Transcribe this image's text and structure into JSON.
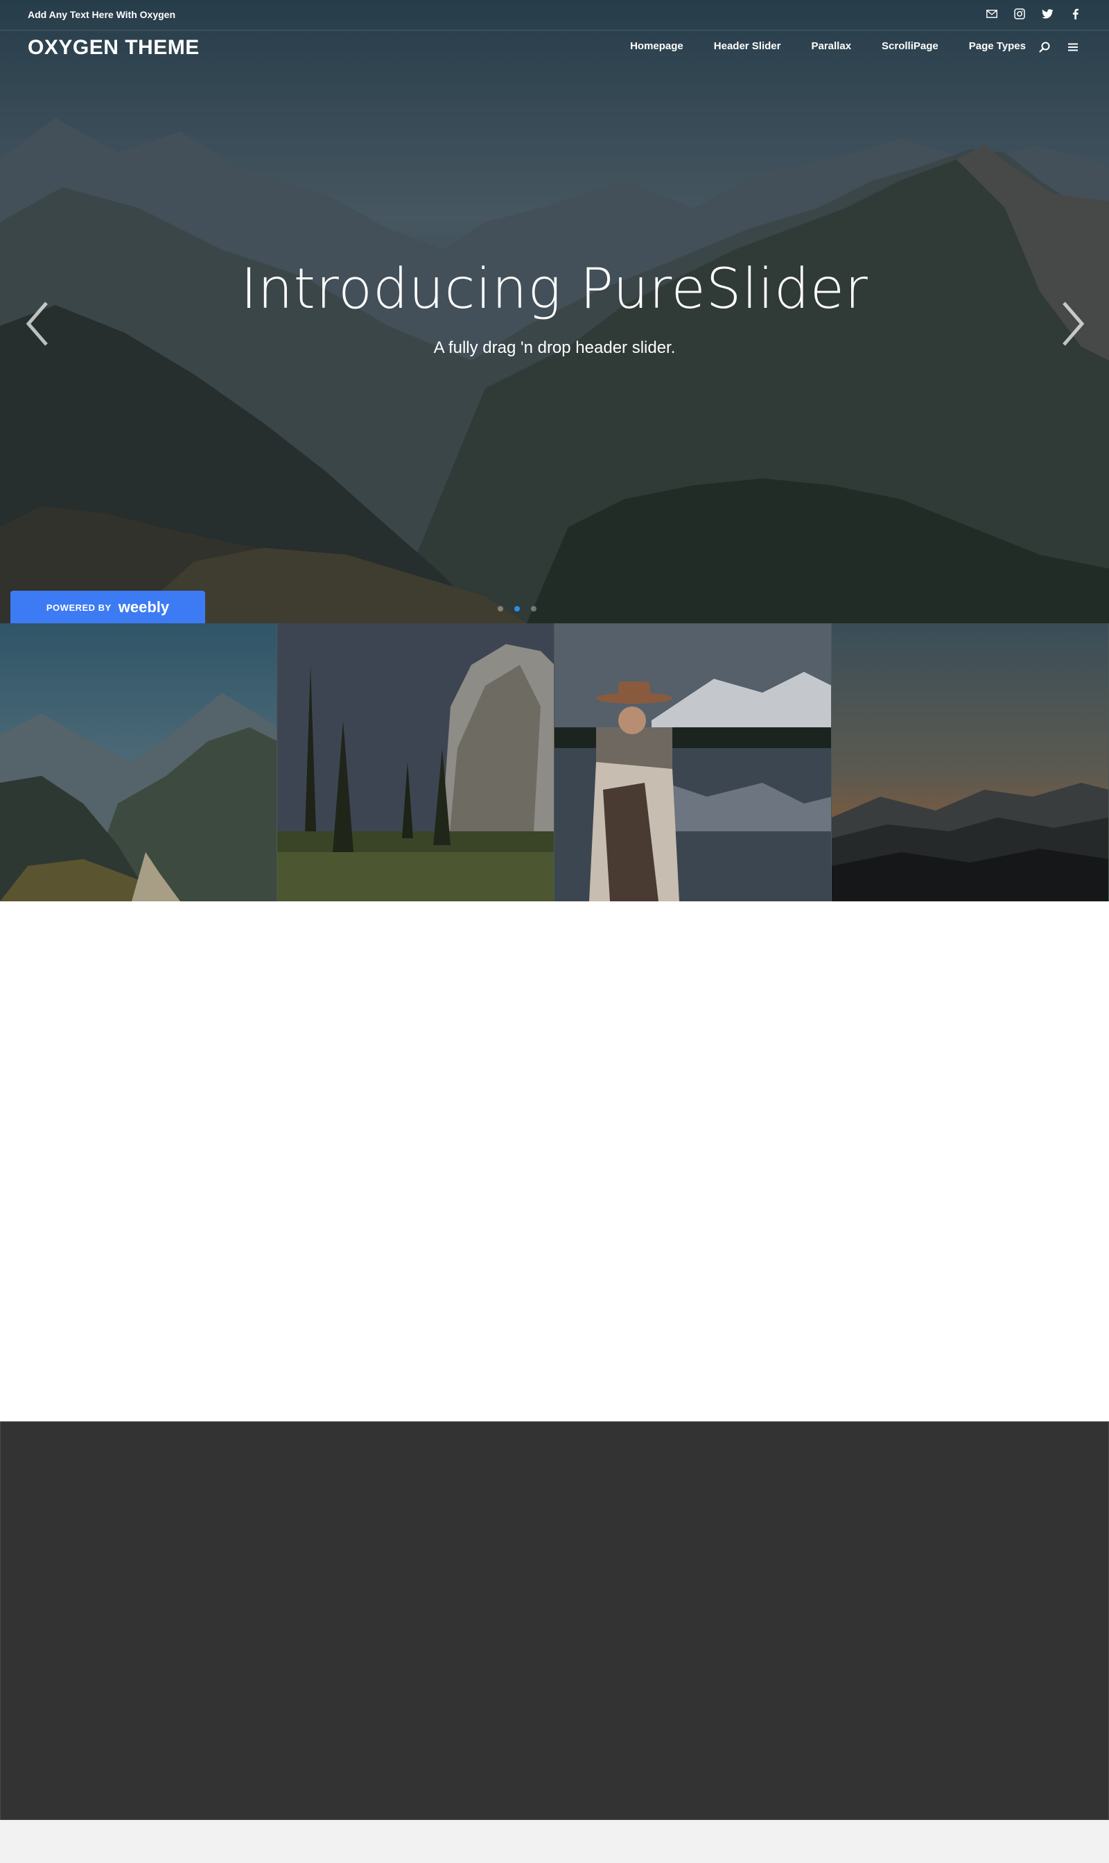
{
  "topbar": {
    "text": "Add Any Text Here With Oxygen",
    "social_icons": [
      "mail-icon",
      "instagram-icon",
      "twitter-icon",
      "facebook-icon"
    ]
  },
  "header": {
    "logo": "OXYGEN THEME",
    "nav": [
      "Homepage",
      "Header Slider",
      "Parallax",
      "ScrolliPage",
      "Page Types"
    ],
    "icons": [
      "search-icon",
      "menu-icon"
    ]
  },
  "slider": {
    "title": "Introducing PureSlider",
    "subtitle": "A fully drag 'n drop header slider.",
    "dots_count": 3,
    "active_dot": 1,
    "accent_color": "#2a8fe0"
  },
  "badge": {
    "powered_by": "POWERED BY",
    "brand": "weebly",
    "color": "#3c7bf4"
  },
  "gallery": {
    "tiles": [
      "mountain-valley",
      "forest-cliff",
      "woman-lake",
      "sunset-hills"
    ]
  },
  "colors": {
    "content_bg": "#ffffff",
    "footer_bg": "#333333",
    "page_bg": "#f2f2f2"
  }
}
